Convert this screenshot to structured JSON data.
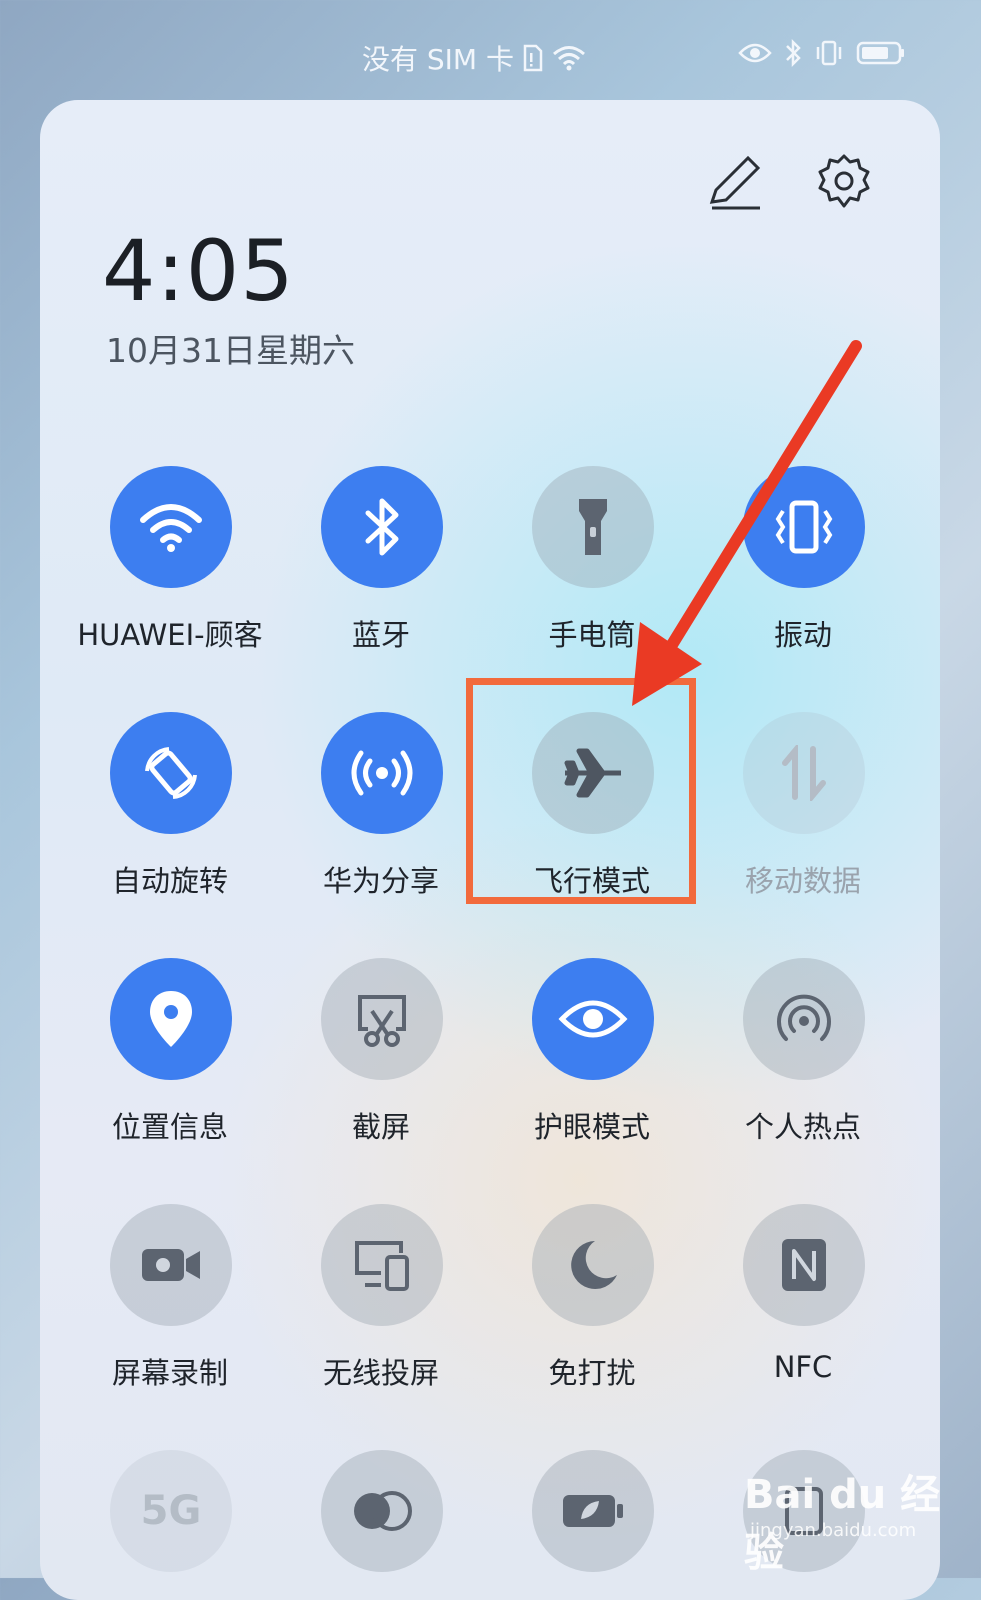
{
  "status_bar": {
    "carrier": "没有 SIM 卡"
  },
  "header": {
    "time": "4:05",
    "date": "10月31日星期六"
  },
  "tiles": [
    {
      "label": "HUAWEI-顾客",
      "icon": "wifi-icon",
      "state": "on"
    },
    {
      "label": "蓝牙",
      "icon": "bluetooth-icon",
      "state": "on"
    },
    {
      "label": "手电筒",
      "icon": "flashlight-icon",
      "state": "off"
    },
    {
      "label": "振动",
      "icon": "vibrate-icon",
      "state": "on"
    },
    {
      "label": "自动旋转",
      "icon": "auto-rotate-icon",
      "state": "on"
    },
    {
      "label": "华为分享",
      "icon": "huawei-share-icon",
      "state": "on"
    },
    {
      "label": "飞行模式",
      "icon": "airplane-icon",
      "state": "off"
    },
    {
      "label": "移动数据",
      "icon": "mobile-data-icon",
      "state": "disabled"
    },
    {
      "label": "位置信息",
      "icon": "location-icon",
      "state": "on"
    },
    {
      "label": "截屏",
      "icon": "screenshot-icon",
      "state": "off"
    },
    {
      "label": "护眼模式",
      "icon": "eye-comfort-icon",
      "state": "on"
    },
    {
      "label": "个人热点",
      "icon": "hotspot-icon",
      "state": "off"
    },
    {
      "label": "屏幕录制",
      "icon": "screen-record-icon",
      "state": "off"
    },
    {
      "label": "无线投屏",
      "icon": "wireless-projection-icon",
      "state": "off"
    },
    {
      "label": "免打扰",
      "icon": "do-not-disturb-icon",
      "state": "off"
    },
    {
      "label": "NFC",
      "icon": "nfc-icon",
      "state": "off"
    },
    {
      "label": "5G",
      "icon": "5g-icon",
      "state": "disabled"
    },
    {
      "label": "",
      "icon": "color-mode-icon",
      "state": "off"
    },
    {
      "label": "",
      "icon": "power-saving-icon",
      "state": "off"
    },
    {
      "label": "",
      "icon": "more-icon",
      "state": "off"
    }
  ],
  "colors": {
    "accent_on": "#3d7ef0",
    "highlight": "#f26a3c"
  },
  "watermark": {
    "brand": "Bai du 经验",
    "url": "jingyan.baidu.com"
  }
}
